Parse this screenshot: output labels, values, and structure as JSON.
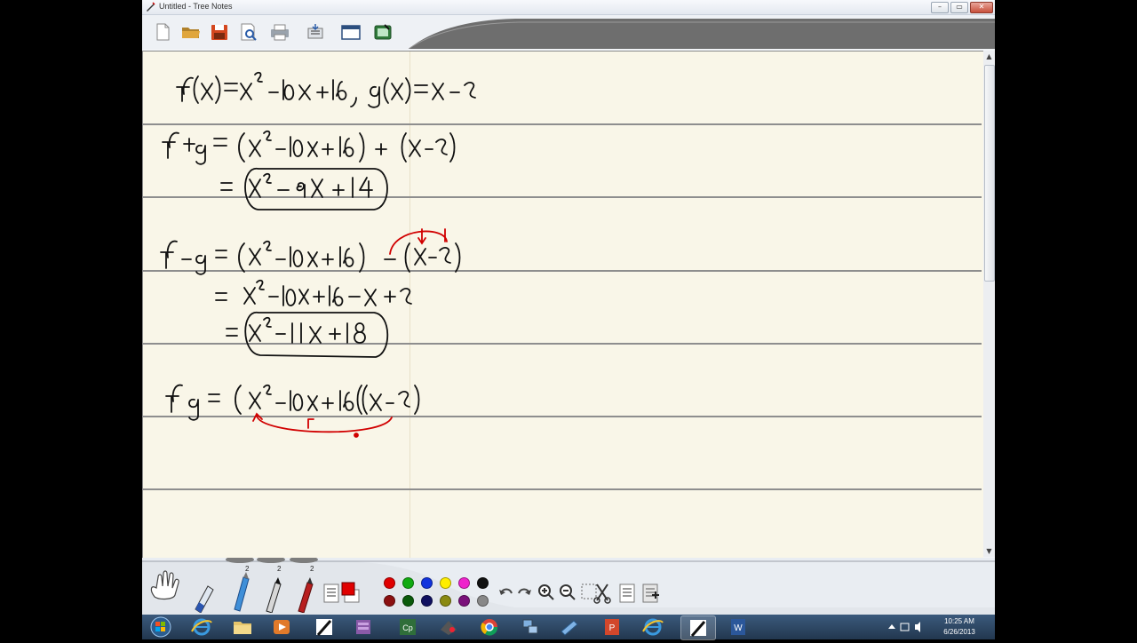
{
  "window": {
    "title": "Untitled - Tree Notes",
    "controls": [
      "–",
      "▭",
      "✕"
    ]
  },
  "toolbar": {
    "buttons": [
      "new-page",
      "open",
      "save",
      "print-preview",
      "print",
      "paste",
      "fullscreen",
      "capture"
    ]
  },
  "notes": {
    "line1": "f(x) = x² − 10x + 16 , g(x) = x − 2",
    "line2": "f + g = (x² − 10x + 16) + (x − 2)",
    "line3": "= x² − 9x + 14",
    "line4": "f − g = (x² − 10x + 16) − (x − 2)",
    "line5": "= x² − 10x + 16 − x + 2",
    "line6": "= x² − 11x + 18",
    "line7": "fg = (x² − 10x + 16)(x − 2)"
  },
  "palette": {
    "pen_widths": [
      "2",
      "2",
      "2"
    ],
    "colors_row1": [
      "#e00000",
      "#11aa11",
      "#1133dd",
      "#ffee00",
      "#ee22cc",
      "#111111"
    ],
    "colors_row2": [
      "#8b1010",
      "#0a5a0a",
      "#101060",
      "#8a8a10",
      "#7a107a",
      "#888888"
    ]
  },
  "taskbar": {
    "apps": [
      "start",
      "internet-explorer",
      "file-explorer",
      "media-player",
      "tree-notes",
      "archive",
      "cp",
      "pen-tool",
      "chrome",
      "network",
      "notes",
      "powerpoint",
      "internet-explorer-2",
      "tree-notes-active",
      "word"
    ],
    "time": "10:25 AM",
    "date": "6/26/2013"
  }
}
